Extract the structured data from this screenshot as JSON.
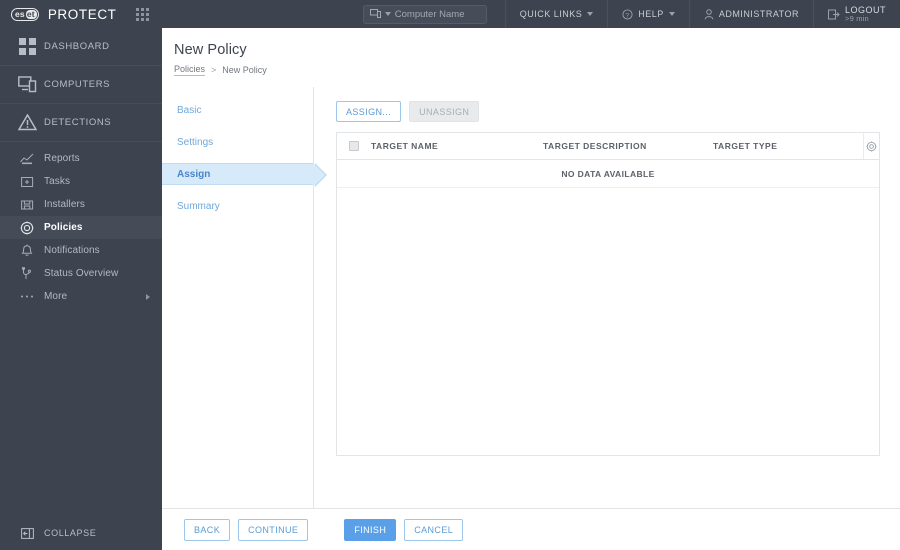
{
  "topbar": {
    "logo_text_a": "es",
    "logo_text_b": "et",
    "product_name": "PROTECT",
    "apps_icon": "apps-grid-icon",
    "search": {
      "placeholder": "Computer Name",
      "icon": "computer-icon",
      "caret": "chevron-down-icon"
    },
    "quick_links": "QUICK LINKS",
    "help": "HELP",
    "administrator": "ADMINISTRATOR",
    "logout": "LOGOUT",
    "logout_timer": ">9 min"
  },
  "sidebar": {
    "main_items": [
      {
        "label": "DASHBOARD",
        "icon": "dashboard-icon"
      },
      {
        "label": "COMPUTERS",
        "icon": "computers-icon"
      },
      {
        "label": "DETECTIONS",
        "icon": "warning-triangle-icon"
      }
    ],
    "sub_items": [
      {
        "label": "Reports",
        "icon": "reports-chart-icon",
        "active": false
      },
      {
        "label": "Tasks",
        "icon": "tasks-icon",
        "active": false
      },
      {
        "label": "Installers",
        "icon": "installers-icon",
        "active": false
      },
      {
        "label": "Policies",
        "icon": "policies-gear-icon",
        "active": true
      },
      {
        "label": "Notifications",
        "icon": "bell-icon",
        "active": false
      },
      {
        "label": "Status Overview",
        "icon": "status-overview-icon",
        "active": false
      },
      {
        "label": "More",
        "icon": "ellipsis-icon",
        "active": false,
        "chevron": "chevron-right-icon"
      }
    ],
    "collapse": {
      "label": "COLLAPSE",
      "icon": "collapse-panel-icon"
    }
  },
  "page": {
    "title": "New Policy",
    "breadcrumb": {
      "parent": "Policies",
      "separator": ">",
      "current": "New Policy"
    }
  },
  "wizard": {
    "steps": [
      {
        "label": "Basic",
        "active": false
      },
      {
        "label": "Settings",
        "active": false
      },
      {
        "label": "Assign",
        "active": true
      },
      {
        "label": "Summary",
        "active": false
      }
    ]
  },
  "toolbar": {
    "assign_label": "ASSIGN...",
    "unassign_label": "UNASSIGN"
  },
  "table": {
    "columns": {
      "target_name": "TARGET NAME",
      "target_description": "TARGET DESCRIPTION",
      "target_type": "TARGET TYPE"
    },
    "gear_icon": "table-settings-gear-icon",
    "empty_message": "NO DATA AVAILABLE",
    "rows": []
  },
  "footer": {
    "back": "BACK",
    "continue": "CONTINUE",
    "finish": "FINISH",
    "cancel": "CANCEL"
  },
  "colors": {
    "sidebar_bg": "#3d4450",
    "accent_blue": "#5aa0e8",
    "step_active_bg": "#d6eaf9",
    "link_blue": "#6fa8dc",
    "border": "#e2e5e8"
  }
}
